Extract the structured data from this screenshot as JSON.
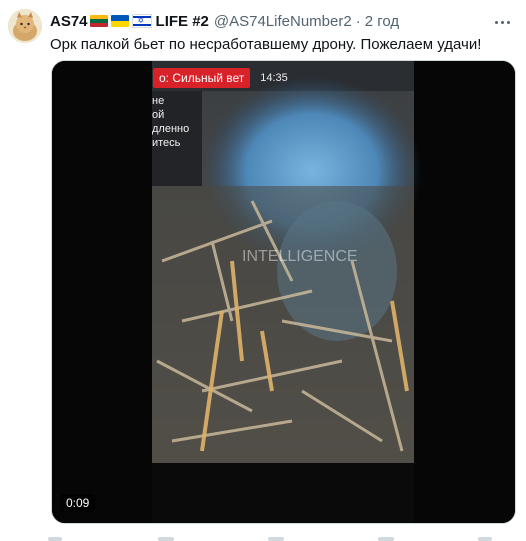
{
  "tweet": {
    "display_name": "AS74",
    "display_name_suffix": "LIFE #2",
    "handle": "@AS74LifeNumber2",
    "separator": "·",
    "time": "2 год",
    "text": "Орк палкой бьет по несработавшему дрону. Пожелаем удачи!",
    "flags": [
      "lithuania-flag",
      "ukraine-flag",
      "israel-flag"
    ]
  },
  "media": {
    "duration": "0:09",
    "overlay_tag": "о: Сильный вет",
    "overlay_time": "14:35",
    "side_text_lines": [
      "не",
      "ой",
      "дленно",
      "итесь"
    ],
    "watermark": "INTELLIGENCE"
  },
  "colors": {
    "text": "#0f1419",
    "secondary": "#536471",
    "tag_red": "#d8222a",
    "smoke_blue": "#5ea3d8"
  }
}
